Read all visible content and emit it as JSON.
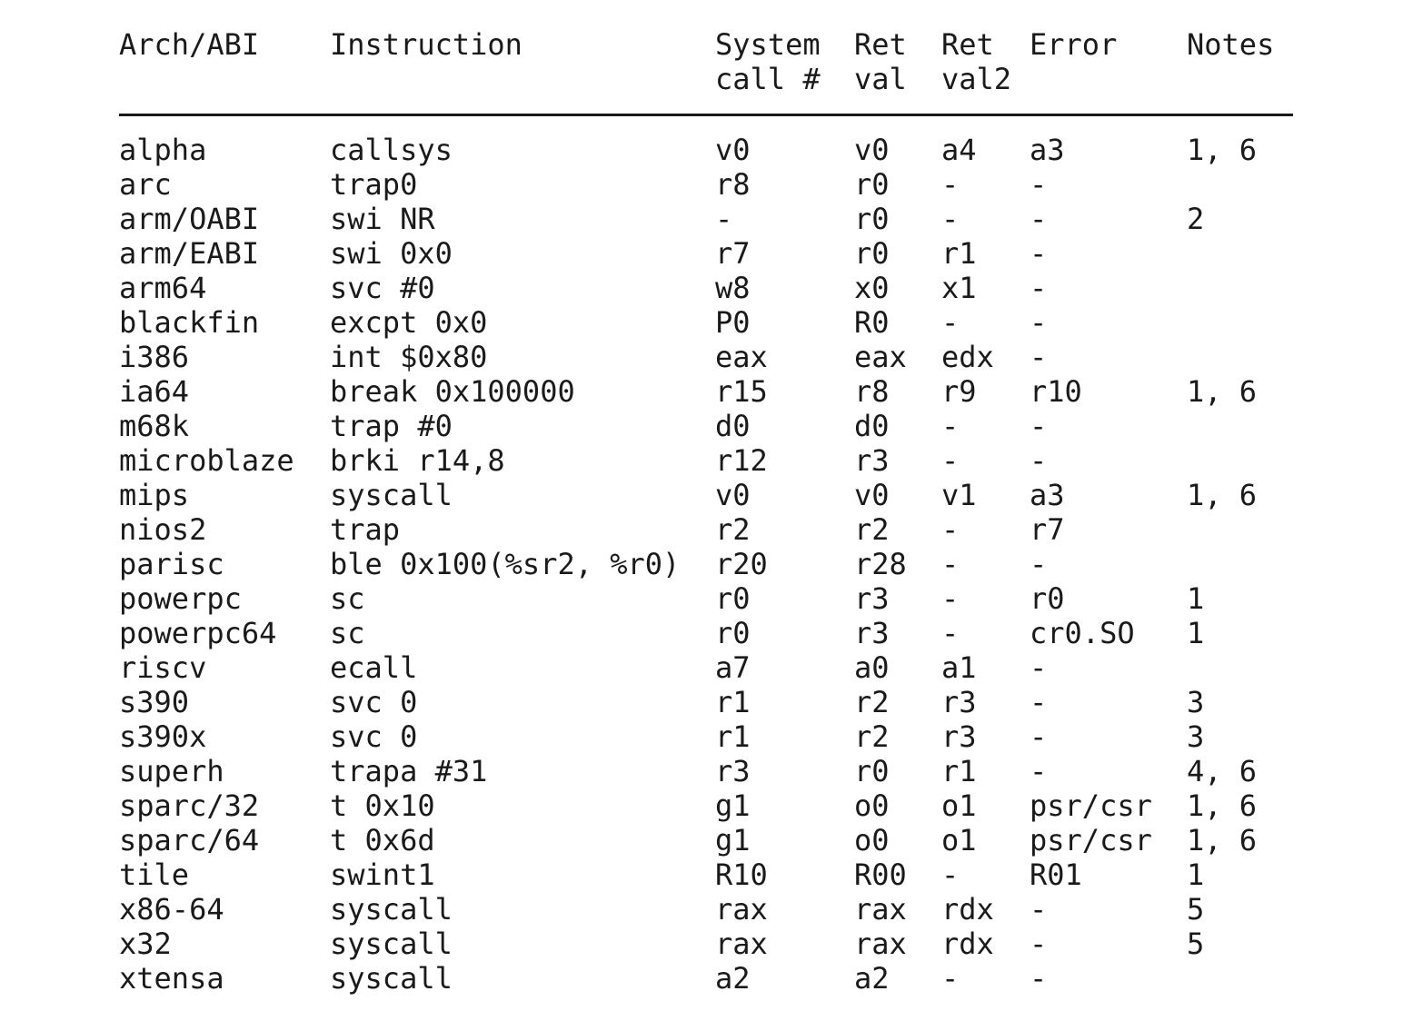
{
  "headers": {
    "arch": "Arch/ABI",
    "instruction": "Instruction",
    "syscall_no": "System\ncall #",
    "ret_val": "Ret\nval",
    "ret_val2": "Ret\nval2",
    "error": "Error",
    "notes": "Notes"
  },
  "rows": [
    {
      "arch": "alpha",
      "instruction": "callsys",
      "syscall_no": "v0",
      "ret_val": "v0",
      "ret_val2": "a4",
      "error": "a3",
      "notes": "1, 6"
    },
    {
      "arch": "arc",
      "instruction": "trap0",
      "syscall_no": "r8",
      "ret_val": "r0",
      "ret_val2": "-",
      "error": "-",
      "notes": ""
    },
    {
      "arch": "arm/OABI",
      "instruction": "swi NR",
      "syscall_no": "-",
      "ret_val": "r0",
      "ret_val2": "-",
      "error": "-",
      "notes": "2"
    },
    {
      "arch": "arm/EABI",
      "instruction": "swi 0x0",
      "syscall_no": "r7",
      "ret_val": "r0",
      "ret_val2": "r1",
      "error": "-",
      "notes": ""
    },
    {
      "arch": "arm64",
      "instruction": "svc #0",
      "syscall_no": "w8",
      "ret_val": "x0",
      "ret_val2": "x1",
      "error": "-",
      "notes": ""
    },
    {
      "arch": "blackfin",
      "instruction": "excpt 0x0",
      "syscall_no": "P0",
      "ret_val": "R0",
      "ret_val2": "-",
      "error": "-",
      "notes": ""
    },
    {
      "arch": "i386",
      "instruction": "int $0x80",
      "syscall_no": "eax",
      "ret_val": "eax",
      "ret_val2": "edx",
      "error": "-",
      "notes": ""
    },
    {
      "arch": "ia64",
      "instruction": "break 0x100000",
      "syscall_no": "r15",
      "ret_val": "r8",
      "ret_val2": "r9",
      "error": "r10",
      "notes": "1, 6"
    },
    {
      "arch": "m68k",
      "instruction": "trap #0",
      "syscall_no": "d0",
      "ret_val": "d0",
      "ret_val2": "-",
      "error": "-",
      "notes": ""
    },
    {
      "arch": "microblaze",
      "instruction": "brki r14,8",
      "syscall_no": "r12",
      "ret_val": "r3",
      "ret_val2": "-",
      "error": "-",
      "notes": ""
    },
    {
      "arch": "mips",
      "instruction": "syscall",
      "syscall_no": "v0",
      "ret_val": "v0",
      "ret_val2": "v1",
      "error": "a3",
      "notes": "1, 6"
    },
    {
      "arch": "nios2",
      "instruction": "trap",
      "syscall_no": "r2",
      "ret_val": "r2",
      "ret_val2": "-",
      "error": "r7",
      "notes": ""
    },
    {
      "arch": "parisc",
      "instruction": "ble 0x100(%sr2, %r0)",
      "syscall_no": "r20",
      "ret_val": "r28",
      "ret_val2": "-",
      "error": "-",
      "notes": ""
    },
    {
      "arch": "powerpc",
      "instruction": "sc",
      "syscall_no": "r0",
      "ret_val": "r3",
      "ret_val2": "-",
      "error": "r0",
      "notes": "1"
    },
    {
      "arch": "powerpc64",
      "instruction": "sc",
      "syscall_no": "r0",
      "ret_val": "r3",
      "ret_val2": "-",
      "error": "cr0.SO",
      "notes": "1"
    },
    {
      "arch": "riscv",
      "instruction": "ecall",
      "syscall_no": "a7",
      "ret_val": "a0",
      "ret_val2": "a1",
      "error": "-",
      "notes": ""
    },
    {
      "arch": "s390",
      "instruction": "svc 0",
      "syscall_no": "r1",
      "ret_val": "r2",
      "ret_val2": "r3",
      "error": "-",
      "notes": "3"
    },
    {
      "arch": "s390x",
      "instruction": "svc 0",
      "syscall_no": "r1",
      "ret_val": "r2",
      "ret_val2": "r3",
      "error": "-",
      "notes": "3"
    },
    {
      "arch": "superh",
      "instruction": "trapa #31",
      "syscall_no": "r3",
      "ret_val": "r0",
      "ret_val2": "r1",
      "error": "-",
      "notes": "4, 6"
    },
    {
      "arch": "sparc/32",
      "instruction": "t 0x10",
      "syscall_no": "g1",
      "ret_val": "o0",
      "ret_val2": "o1",
      "error": "psr/csr",
      "notes": "1, 6"
    },
    {
      "arch": "sparc/64",
      "instruction": "t 0x6d",
      "syscall_no": "g1",
      "ret_val": "o0",
      "ret_val2": "o1",
      "error": "psr/csr",
      "notes": "1, 6"
    },
    {
      "arch": "tile",
      "instruction": "swint1",
      "syscall_no": "R10",
      "ret_val": "R00",
      "ret_val2": "-",
      "error": "R01",
      "notes": "1"
    },
    {
      "arch": "x86-64",
      "instruction": "syscall",
      "syscall_no": "rax",
      "ret_val": "rax",
      "ret_val2": "rdx",
      "error": "-",
      "notes": "5"
    },
    {
      "arch": "x32",
      "instruction": "syscall",
      "syscall_no": "rax",
      "ret_val": "rax",
      "ret_val2": "rdx",
      "error": "-",
      "notes": "5"
    },
    {
      "arch": "xtensa",
      "instruction": "syscall",
      "syscall_no": "a2",
      "ret_val": "a2",
      "ret_val2": "-",
      "error": "-",
      "notes": ""
    }
  ]
}
